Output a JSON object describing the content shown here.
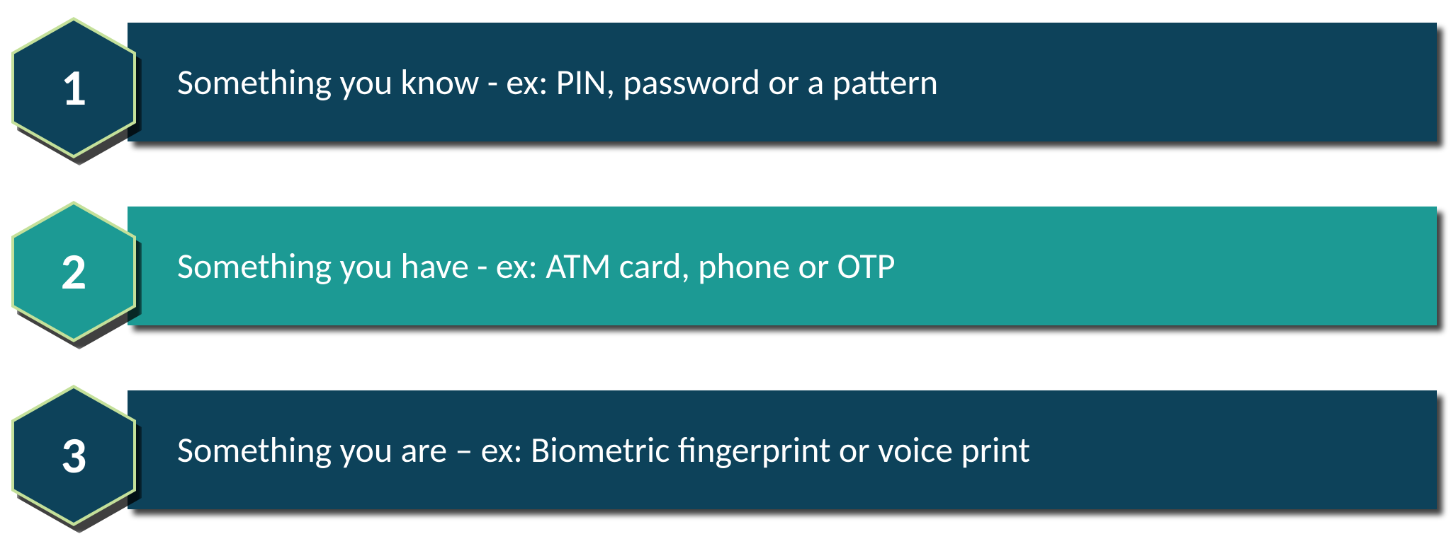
{
  "rows": [
    {
      "number": "1",
      "text": "Something you know - ex: PIN, password or a pattern",
      "color": "dark"
    },
    {
      "number": "2",
      "text": "Something you have - ex: ATM card, phone or OTP",
      "color": "teal"
    },
    {
      "number": "3",
      "text": "Something you are – ex: Biometric fingerprint or voice print",
      "color": "dark"
    }
  ],
  "colors": {
    "dark": "#0d425a",
    "teal": "#1c9a94",
    "hex_border": "#c4e09a"
  }
}
